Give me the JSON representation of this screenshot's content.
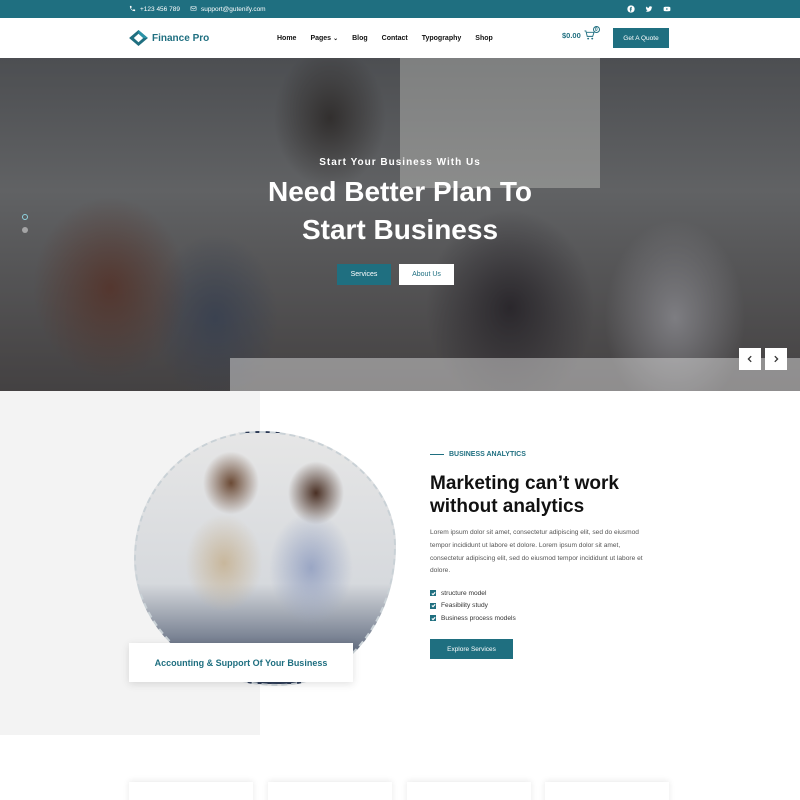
{
  "topbar": {
    "phone": "+123 456 789",
    "email": "support@gutenify.com",
    "social_icons": [
      "facebook-icon",
      "twitter-icon",
      "youtube-icon"
    ]
  },
  "header": {
    "logo_text": "Finance Pro",
    "nav": [
      {
        "label": "Home"
      },
      {
        "label": "Pages",
        "has_dropdown": true
      },
      {
        "label": "Blog"
      },
      {
        "label": "Contact"
      },
      {
        "label": "Typography"
      },
      {
        "label": "Shop"
      }
    ],
    "cart_amount": "$0.00",
    "cart_count": "0",
    "cta_label": "Get A Quote"
  },
  "hero": {
    "subtitle": "Start Your Business With Us",
    "title_line1": "Need Better Plan To",
    "title_line2": "Start Business",
    "btn_services": "Services",
    "btn_about": "About Us",
    "slides": 2,
    "active_slide": 1
  },
  "about": {
    "photo_caption": "Accounting & Support Of Your Business",
    "eyebrow": "BUSINESS ANALYTICS",
    "title_line1": "Marketing can’t work",
    "title_line2": "without analytics",
    "paragraph_lines": [
      "Lorem ipsum dolor sit amet, consectetur adipiscing elit, sed do eiusmod",
      "tempor incididunt ut labore et dolore. Lorem ipsum dolor sit amet,",
      "consectetur adipiscing elit, sed do eiusmod tempor incididunt ut labore et",
      "dolore."
    ],
    "checklist": [
      "structure model",
      "Feasibility study",
      "Business process models"
    ],
    "cta_label": "Explore Services"
  },
  "colors": {
    "brand": "#1f6f80",
    "light_bg": "#f3f3f3"
  }
}
